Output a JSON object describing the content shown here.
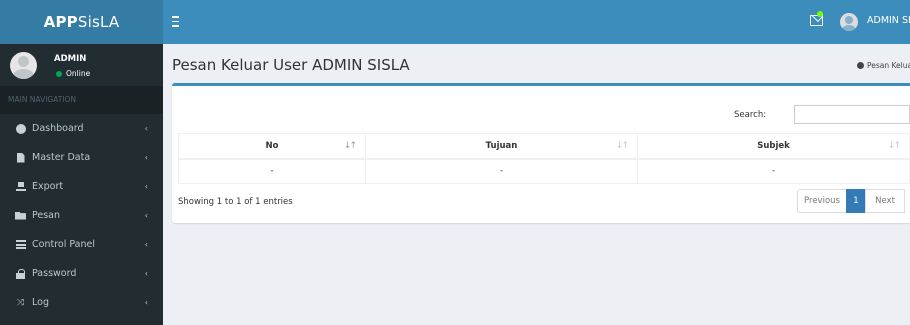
{
  "brand": {
    "bold": "APP",
    "light": "SisLA"
  },
  "header": {
    "user_name": "ADMIN SISLA"
  },
  "sidebar": {
    "user": {
      "name": "ADMIN",
      "status": "Online"
    },
    "nav_header": "MAIN NAVIGATION",
    "items": [
      {
        "label": "Dashboard",
        "icon": "dashboard-icon"
      },
      {
        "label": "Master Data",
        "icon": "file-icon"
      },
      {
        "label": "Export",
        "icon": "export-icon"
      },
      {
        "label": "Pesan",
        "icon": "folder-icon"
      },
      {
        "label": "Control Panel",
        "icon": "control-panel-icon"
      },
      {
        "label": "Password",
        "icon": "lock-icon"
      },
      {
        "label": "Log",
        "icon": "random-icon"
      }
    ],
    "chevron": "‹"
  },
  "page": {
    "title": "Pesan Keluar User ADMIN SISLA",
    "breadcrumb": "Pesan Kelua"
  },
  "table": {
    "search_label": "Search:",
    "search_value": "",
    "columns": [
      "No",
      "Tujuan",
      "Subjek"
    ],
    "rows": [
      [
        "-",
        "-",
        "-"
      ]
    ],
    "info": "Showing 1 to 1 of 1 entries"
  },
  "pagination": {
    "previous": "Previous",
    "current": "1",
    "next": "Next"
  },
  "colors": {
    "header": "#3c8dbc",
    "logo": "#357ca5",
    "sidebar": "#222d32",
    "active_page": "#337ab7"
  }
}
